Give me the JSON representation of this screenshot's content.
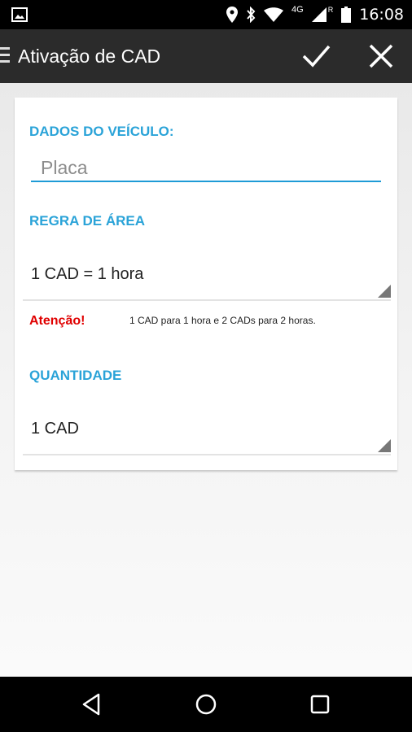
{
  "status_bar": {
    "time": "16:08",
    "network": "4G",
    "roaming": "R",
    "icons": [
      "image-icon",
      "location-icon",
      "bluetooth-icon",
      "wifi-icon",
      "signal-icon",
      "battery-icon"
    ]
  },
  "app_bar": {
    "title": "Ativação de CAD",
    "icons": [
      "menu-icon",
      "check-icon",
      "close-icon"
    ]
  },
  "form": {
    "vehicle_label": "DADOS DO VEÍCULO:",
    "plate_placeholder": "Placa",
    "plate_value": "",
    "area_rule_label": "REGRA DE ÁREA",
    "area_rule_value": "1 CAD = 1 hora",
    "attention_label": "Atenção!",
    "attention_message": "1 CAD para 1 hora e 2 CADs para 2 horas.",
    "quantity_label": "QUANTIDADE",
    "quantity_value": "1 CAD"
  },
  "nav_bar": {
    "icons": [
      "back-icon",
      "home-icon",
      "recents-icon"
    ]
  },
  "colors": {
    "accent": "#2aa3d8",
    "warning": "#e00000",
    "app_bar": "#2b2b2b"
  }
}
